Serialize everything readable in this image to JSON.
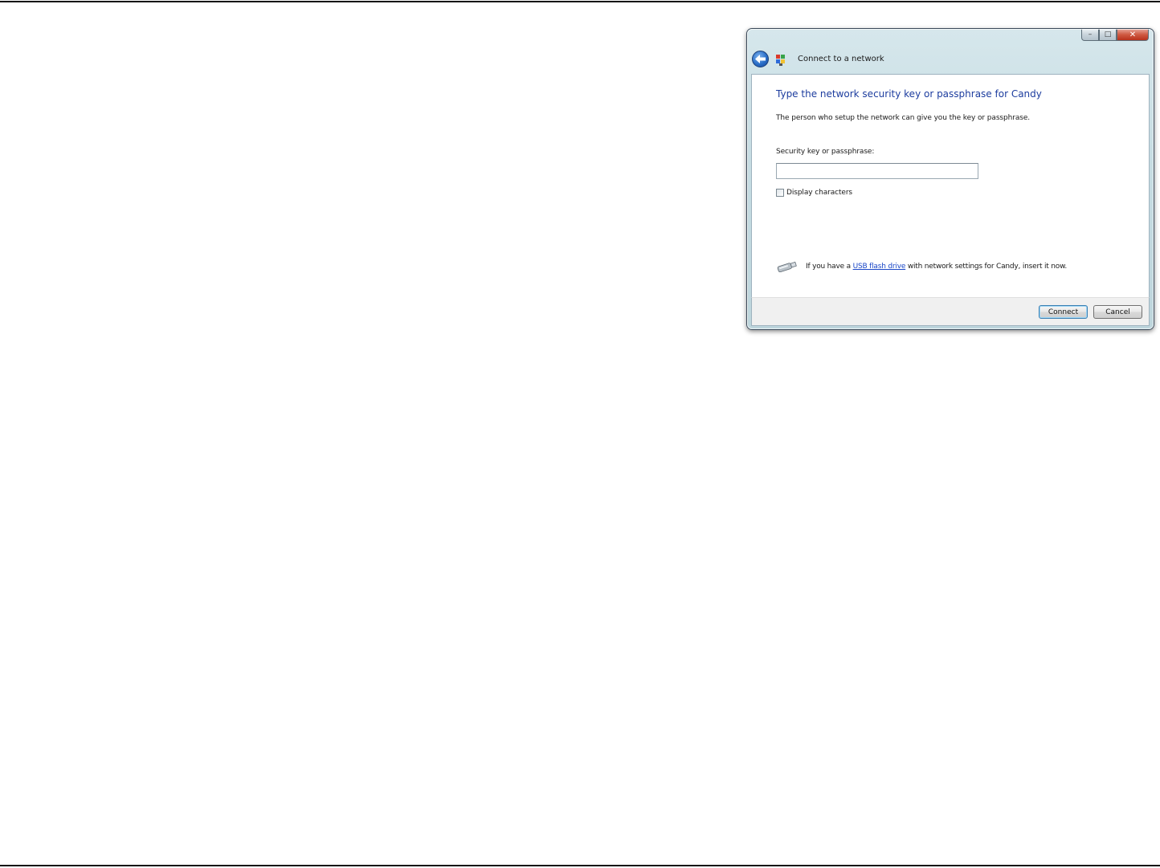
{
  "window": {
    "title": "Connect to a network",
    "caption_buttons": {
      "minimize": "–",
      "maximize": "□",
      "close": "✕"
    }
  },
  "content": {
    "heading": "Type the network security key or passphrase for Candy",
    "description": "The person who setup the network can give you the key or passphrase.",
    "key_label": "Security key or passphrase:",
    "key_value": "",
    "display_characters_label": "Display characters",
    "display_characters_checked": false,
    "usb": {
      "prefix": "If you have a ",
      "link": "USB flash drive",
      "suffix": " with network settings for Candy, insert it now."
    }
  },
  "footer": {
    "connect_label": "Connect",
    "cancel_label": "Cancel"
  },
  "icons": [
    "back-arrow-icon",
    "network-icon",
    "usb-drive-icon"
  ],
  "colors": {
    "heading": "#1c3c9e",
    "link": "#1a47c7",
    "close_button": "#c9452d"
  }
}
